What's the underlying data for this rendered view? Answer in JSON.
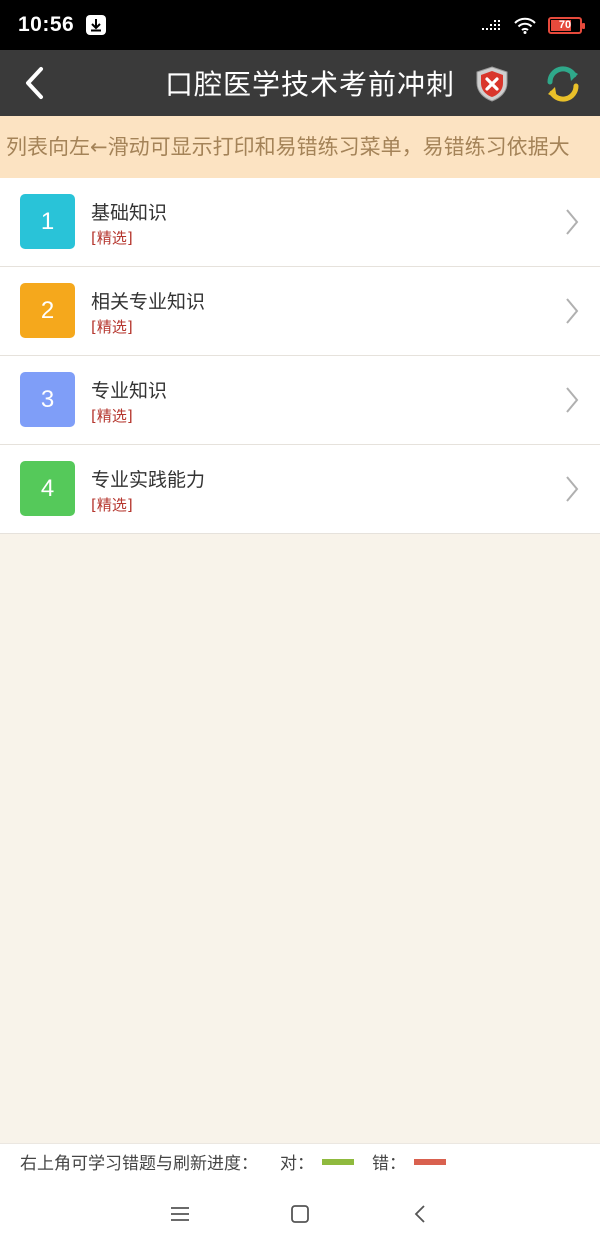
{
  "status_bar": {
    "time": "10:56",
    "battery_text": "70",
    "battery_level": 0.7
  },
  "header": {
    "title": "口腔医学技术考前冲刺",
    "back_icon": "chevron-left-icon",
    "wrong_icon": "shield-x-icon",
    "refresh_icon": "refresh-icon"
  },
  "notice": {
    "text": "列表向左←滑动可显示打印和易错练习菜单，易错练习依据大"
  },
  "list": {
    "items": [
      {
        "number": "1",
        "title": "基础知识",
        "tag": "[精选]",
        "color": "#29c3d8"
      },
      {
        "number": "2",
        "title": "相关专业知识",
        "tag": "[精选]",
        "color": "#f5a81c"
      },
      {
        "number": "3",
        "title": "专业知识",
        "tag": "[精选]",
        "color": "#7f9ef8"
      },
      {
        "number": "4",
        "title": "专业实践能力",
        "tag": "[精选]",
        "color": "#55c95a"
      }
    ]
  },
  "legend": {
    "text": "右上角可学习错题与刷新进度：",
    "correct_label": "对：",
    "correct_color": "#8fba3e",
    "wrong_label": "错：",
    "wrong_color": "#d9614f"
  },
  "navbar": {
    "menu_icon": "menu-icon",
    "home_icon": "home-square-icon",
    "back_icon": "back-triangle-icon"
  }
}
